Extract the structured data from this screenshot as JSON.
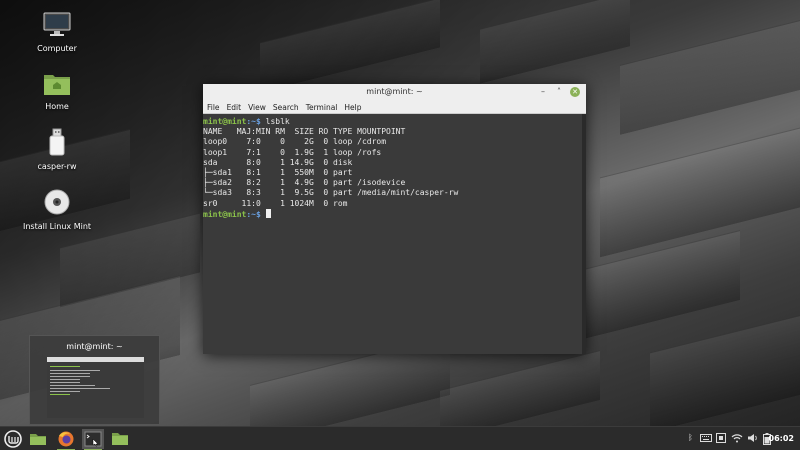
{
  "desktop": {
    "icons": [
      {
        "label": "Computer",
        "icon": "monitor-icon"
      },
      {
        "label": "Home",
        "icon": "home-folder-icon"
      },
      {
        "label": "casper-rw",
        "icon": "usb-drive-icon"
      },
      {
        "label": "Install Linux Mint",
        "icon": "disc-icon"
      }
    ]
  },
  "terminal": {
    "title": "mint@mint: ~",
    "menu": [
      "File",
      "Edit",
      "View",
      "Search",
      "Terminal",
      "Help"
    ],
    "prompt_user": "mint@mint",
    "prompt_sep": ":~$",
    "command": " lsblk",
    "output": [
      "NAME   MAJ:MIN RM  SIZE RO TYPE MOUNTPOINT",
      "loop0    7:0    0    2G  0 loop /cdrom",
      "loop1    7:1    0  1.9G  1 loop /rofs",
      "sda      8:0    1 14.9G  0 disk",
      "├─sda1   8:1    1  550M  0 part",
      "├─sda2   8:2    1  4.9G  0 part /isodevice",
      "└─sda3   8:3    1  9.5G  0 part /media/mint/casper-rw",
      "sr0     11:0    1 1024M  0 rom"
    ],
    "colors": {
      "user": "#8bc24a",
      "path": "#6aa0e0",
      "bg": "#3a3a3a"
    }
  },
  "preview": {
    "title": "mint@mint: ~"
  },
  "taskbar": {
    "items": [
      "mint-menu-icon",
      "folder-icon",
      "firefox-icon",
      "terminal-icon",
      "files-icon"
    ],
    "tray": [
      "bluetooth-icon",
      "keyboard-icon",
      "input-method-icon",
      "wifi-icon",
      "volume-icon",
      "battery-icon"
    ],
    "clock": "06:02",
    "accent": "#8bb158"
  }
}
